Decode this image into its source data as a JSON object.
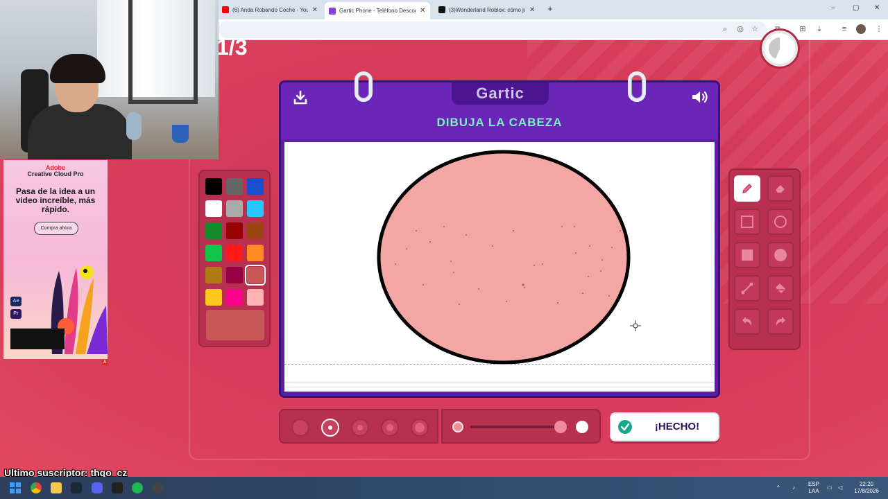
{
  "browser": {
    "tabs": [
      {
        "title": "(6) Anda Robando Coche - YouT",
        "color": "#ff0000",
        "active": false
      },
      {
        "title": "Gartic Phone - Teléfono Descon",
        "color": "#8a3ee0",
        "active": true
      },
      {
        "title": "(3)Wonderland Roblox: cómo ju",
        "color": "#111111",
        "active": false
      }
    ],
    "new_tab": "+",
    "window_controls": [
      "–",
      "▢",
      "✕"
    ]
  },
  "game": {
    "round": "1/3",
    "logo": "Gartic",
    "prompt": "DIBUJA LA CABEZA",
    "done_label": "¡HECHO!",
    "timer_progress": 0.44,
    "palette": {
      "colors": [
        "#000000",
        "#666666",
        "#1a4fd0",
        "#ffffff",
        "#aaaaaa",
        "#29c6ff",
        "#128a2a",
        "#990000",
        "#994411",
        "#13c44a",
        "#ff1a1a",
        "#ff8a22",
        "#b07a16",
        "#990044",
        "#c95757",
        "#ffc81e",
        "#ff008c",
        "#ffb3b3"
      ],
      "selected_index": 14,
      "current_color": "#c95757"
    },
    "tools": [
      "pencil-icon",
      "eraser-icon",
      "square-outline-icon",
      "circle-outline-icon",
      "square-filled-icon",
      "circle-filled-icon",
      "line-icon",
      "bucket-icon",
      "undo-icon",
      "redo-icon"
    ],
    "active_tool": "pencil-icon",
    "brush_sizes_selected": 1,
    "opacity_level": 0.93,
    "drawing": {
      "fill": "#f2a7a5",
      "stroke": "#000000"
    }
  },
  "ad": {
    "brand": "Adobe",
    "product": "Creative Cloud Pro",
    "headline": "Pasa de la idea a un video increíble, más rápido.",
    "cta": "Compra ahora",
    "app_tiles": [
      "Ae",
      "Pr"
    ]
  },
  "stream": {
    "subscriber": "Ultimo suscriptor: thgo_cz"
  },
  "taskbar": {
    "lang_1": "ESP",
    "lang_2": "LAA",
    "time": "22:20",
    "date": "17/8/2026"
  }
}
